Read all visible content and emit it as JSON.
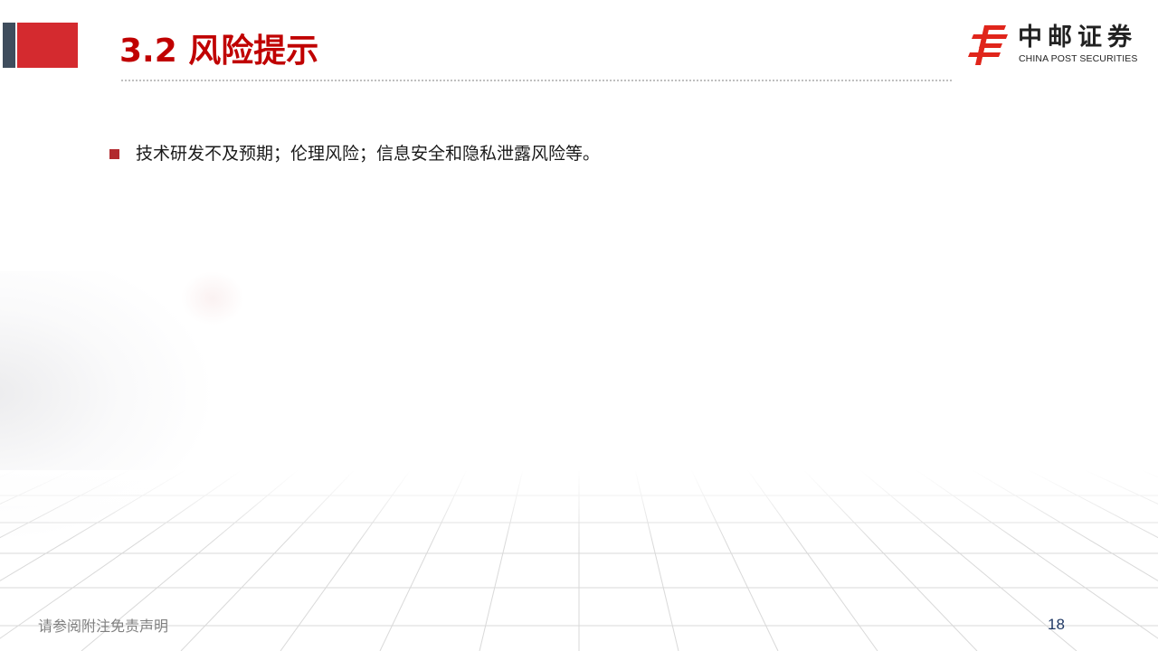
{
  "header": {
    "title": "3.2  风险提示"
  },
  "logo": {
    "name_cn": "中邮证券",
    "name_en": "CHINA POST SECURITIES",
    "icon": "china-post-logo-icon",
    "brand_color": "#e0251b"
  },
  "content": {
    "bullets": [
      {
        "text": "技术研发不及预期；伦理风险；信息安全和隐私泄露风险等。"
      }
    ]
  },
  "footer": {
    "disclaimer": "请参阅附注免责声明",
    "page_number": "18"
  },
  "colors": {
    "title_red": "#c00000",
    "accent_red": "#d42a2f",
    "accent_gray": "#3f4d5d",
    "page_number_blue": "#1f3864"
  }
}
